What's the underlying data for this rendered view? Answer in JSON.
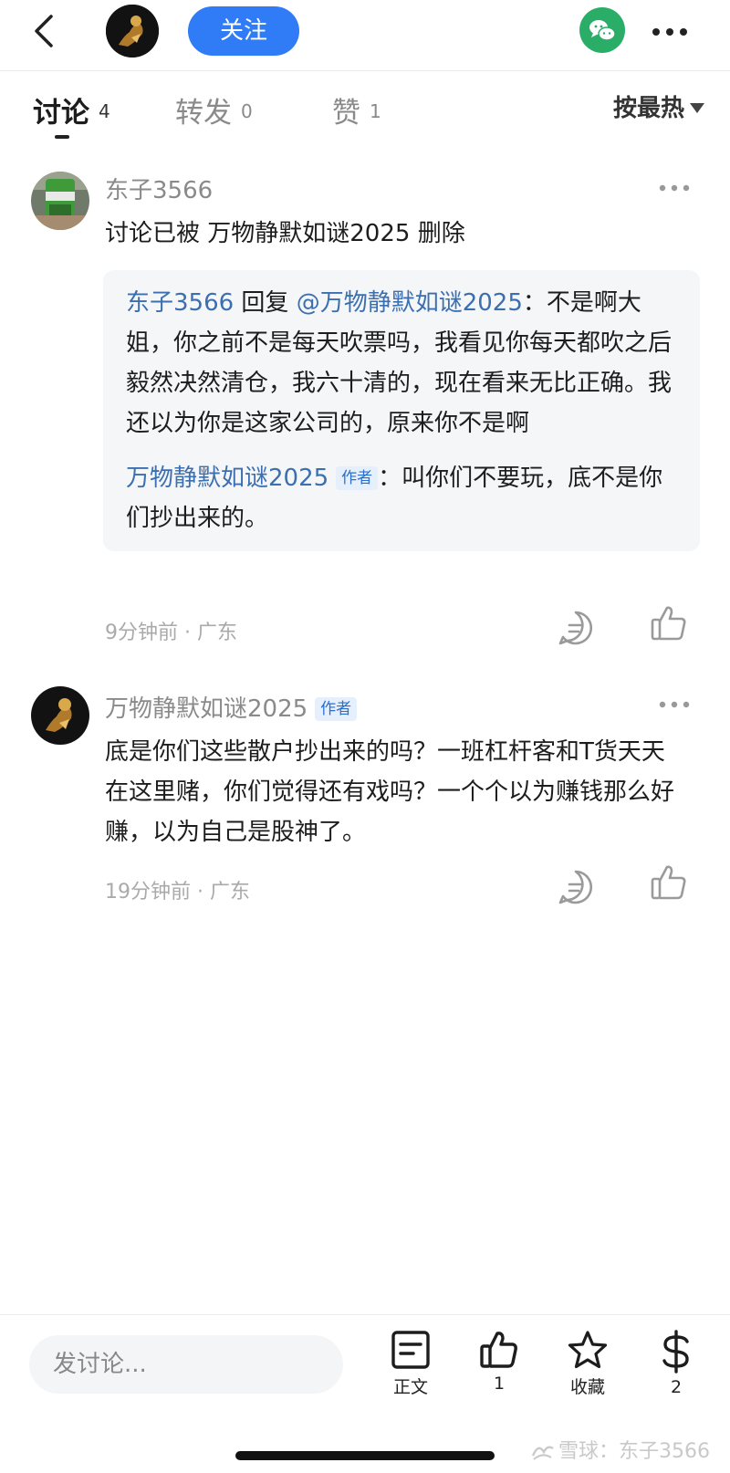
{
  "header": {
    "follow_label": "关注"
  },
  "tabs": [
    {
      "label": "讨论",
      "count": "4"
    },
    {
      "label": "转发",
      "count": "0"
    },
    {
      "label": "赞",
      "count": "1"
    }
  ],
  "sort_label": "按最热",
  "comments": [
    {
      "username": "东子3566",
      "text": "讨论已被 万物静默如谜2025 删除",
      "quote": {
        "reply_user": "东子3566",
        "reply_word": " 回复 ",
        "mention": "@万物静默如谜2025",
        "reply_text": "：不是啊大姐，你之前不是每天吹票吗，我看见你每天都吹之后毅然决然清仓，我六十清的，现在看来无比正确。我还以为你是这家公司的，原来你不是啊",
        "author_name": "万物静默如谜2025",
        "author_tag": "作者",
        "author_text": "：叫你们不要玩，底不是你们抄出来的。"
      },
      "time": "9分钟前",
      "location": "广东"
    },
    {
      "username": "万物静默如谜2025",
      "author_tag": "作者",
      "text": "底是你们这些散户抄出来的吗？一班杠杆客和T货天天在这里赌，你们觉得还有戏吗？一个个以为赚钱那么好赚，以为自己是股神了。",
      "time": "19分钟前",
      "location": "广东"
    }
  ],
  "bottom_bar": {
    "input_placeholder": "发讨论...",
    "items": [
      {
        "label": "正文",
        "icon": "article-icon"
      },
      {
        "label": "1",
        "icon": "like-icon"
      },
      {
        "label": "收藏",
        "icon": "star-icon"
      },
      {
        "label": "2",
        "icon": "dollar-icon"
      }
    ]
  },
  "watermark": {
    "brand": "雪球",
    "sep": "：",
    "user": "东子3566"
  },
  "colors": {
    "accent": "#2f7cf6",
    "wechat": "#2aae67",
    "link_blue": "#3b6fb0",
    "quote_bg": "#f5f6f8"
  }
}
